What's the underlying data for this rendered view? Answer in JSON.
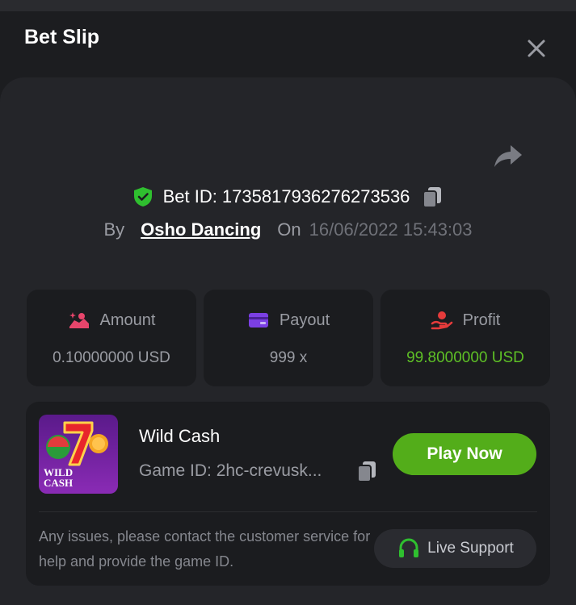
{
  "header": {
    "title": "Bet Slip"
  },
  "bet": {
    "id_text": "Bet ID: 1735817936276273536",
    "by_label": "By",
    "username": "Osho Dancing",
    "on_label": "On",
    "datetime": "16/06/2022 15:43:03"
  },
  "stats": {
    "amount": {
      "label": "Amount",
      "value": "0.10000000 USD",
      "icon": "coins-hand-icon"
    },
    "payout": {
      "label": "Payout",
      "value": "999 x",
      "icon": "card-icon"
    },
    "profit": {
      "label": "Profit",
      "value": "99.8000000 USD",
      "icon": "hand-user-icon"
    }
  },
  "game": {
    "name": "Wild Cash",
    "game_id": "Game ID: 2hc-crevusk...",
    "thumb_text_line1": "WILD",
    "thumb_text_line2": "CASH",
    "play_label": "Play Now",
    "help_text": "Any issues, please contact the customer service for help and provide the game ID.",
    "support_label": "Live Support"
  },
  "colors": {
    "accent_green": "#53ad1a",
    "profit_green": "#5ec026",
    "shield_green": "#2fbf2f",
    "payout_purple": "#7b3fe4",
    "amount_pink": "#e8456b",
    "profit_red": "#e53b3b"
  }
}
